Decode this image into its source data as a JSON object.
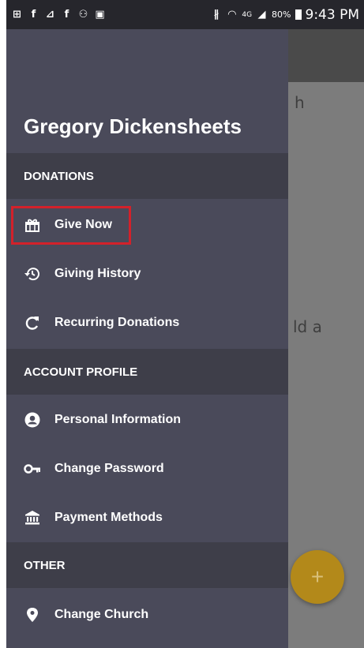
{
  "status_bar": {
    "battery": "80%",
    "network": "4G",
    "time": "9:43 PM"
  },
  "background": {
    "fragment_1": "h",
    "fragment_2": "ld a",
    "fab_symbol": "+"
  },
  "drawer": {
    "user_name": "Gregory Dickensheets",
    "sections": [
      {
        "header": "DONATIONS",
        "items": [
          {
            "label": "Give Now",
            "icon": "gift-icon",
            "highlighted": true
          },
          {
            "label": "Giving History",
            "icon": "history-icon"
          },
          {
            "label": "Recurring Donations",
            "icon": "refresh-icon"
          }
        ]
      },
      {
        "header": "ACCOUNT PROFILE",
        "items": [
          {
            "label": "Personal Information",
            "icon": "account-circle-icon"
          },
          {
            "label": "Change Password",
            "icon": "key-icon"
          },
          {
            "label": "Payment Methods",
            "icon": "bank-icon"
          }
        ]
      },
      {
        "header": "OTHER",
        "items": [
          {
            "label": "Change Church",
            "icon": "location-pin-icon"
          }
        ]
      }
    ]
  },
  "colors": {
    "drawer_bg": "#4a4a5a",
    "section_bg": "#3e3e49",
    "highlight": "#d3212a",
    "fab": "#b3891a"
  }
}
